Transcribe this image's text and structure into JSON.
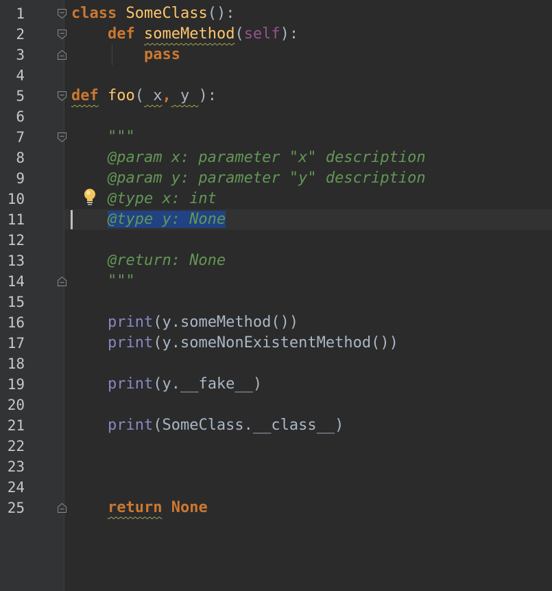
{
  "editor": {
    "line_numbers": [
      "1",
      "2",
      "3",
      "4",
      "5",
      "6",
      "7",
      "8",
      "9",
      "10",
      "11",
      "12",
      "13",
      "14",
      "15",
      "16",
      "17",
      "18",
      "19",
      "20",
      "21",
      "22",
      "23",
      "24",
      "25"
    ],
    "l1": {
      "kw": "class",
      "name": "SomeClass",
      "rest": "():"
    },
    "l2": {
      "kw": "def",
      "name": "someMethod",
      "open": "(",
      "self": "self",
      "close": "):"
    },
    "l3": {
      "kw": "pass"
    },
    "l5": {
      "kw": "def",
      "name": "foo",
      "open": "(",
      "a": " x",
      "sep": ",",
      "b": " y ",
      "close": "):"
    },
    "l7": {
      "doc": "\"\"\""
    },
    "l8": {
      "doc": "@param x: parameter \"x\" description"
    },
    "l9": {
      "doc": "@param y: parameter \"y\" description"
    },
    "l10": {
      "doc": "@type x: int"
    },
    "l11": {
      "doc": "@type y: None"
    },
    "l13": {
      "doc": "@return: None"
    },
    "l14": {
      "doc": "\"\"\""
    },
    "l16": {
      "fn": "print",
      "rest": "(y.someMethod())"
    },
    "l17": {
      "fn": "print",
      "rest": "(y.someNonExistentMethod())"
    },
    "l19": {
      "fn": "print",
      "rest": "(y.__fake__)"
    },
    "l21": {
      "fn": "print",
      "rest": "(SomeClass.__class__)"
    },
    "l25": {
      "kw": "return",
      "val": "None"
    }
  },
  "icons": {
    "fold_open": "fold-open-icon",
    "fold_close": "fold-close-icon",
    "intention": "lightbulb-icon"
  },
  "colors": {
    "background": "#2b2b2b",
    "gutter": "#313335",
    "keyword": "#cc7832",
    "function": "#ffc66d",
    "docstring": "#629755",
    "builtin": "#8888c6",
    "self": "#94558d",
    "selection": "#214283"
  }
}
